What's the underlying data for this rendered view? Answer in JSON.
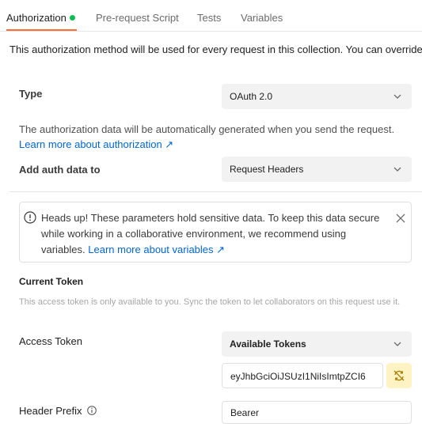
{
  "tabs": [
    {
      "label": "Authorization",
      "active": true,
      "status_dot_color": "#0cbb52"
    },
    {
      "label": "Pre-request Script"
    },
    {
      "label": "Tests"
    },
    {
      "label": "Variables"
    }
  ],
  "intro_text": "This authorization method will be used for every request in this collection. You can override",
  "type": {
    "label": "Type",
    "value": "OAuth 2.0"
  },
  "auth_info": {
    "text": "The authorization data will be automatically generated when you send the request.",
    "link": "Learn more about authorization ↗"
  },
  "add_auth": {
    "label": "Add auth data to",
    "value": "Request Headers"
  },
  "alert": {
    "text": "Heads up! These parameters hold sensitive data. To keep this data secure while working in a collaborative environment, we recommend using variables.",
    "link": "Learn more about variables ↗"
  },
  "current_token": {
    "title": "Current Token",
    "note": "This access token is only available to you. Sync the token to let collaborators on this request use it."
  },
  "access_token": {
    "label": "Access Token",
    "select_value": "Available Tokens",
    "token_value": "eyJhbGciOiJSUzI1NiIsImtpZCI6"
  },
  "header_prefix": {
    "label": "Header Prefix",
    "value": "Bearer"
  },
  "colors": {
    "accent": "#ff6c37",
    "link": "#0265d2",
    "success": "#0cbb52",
    "sync_bg": "#fff3c4"
  }
}
